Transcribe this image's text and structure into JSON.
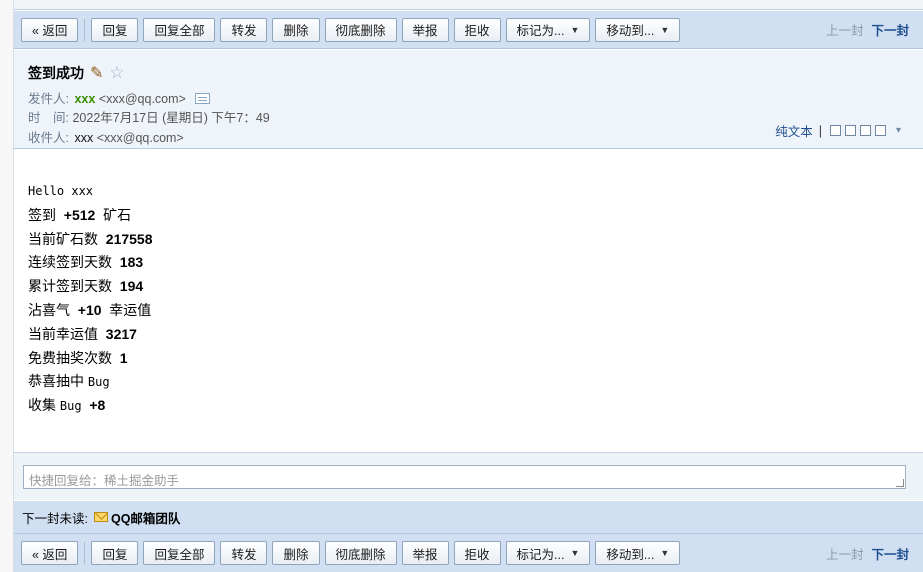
{
  "toolbar": {
    "back": "« 返回",
    "reply": "回复",
    "reply_all": "回复全部",
    "forward": "转发",
    "delete": "删除",
    "delete_permanent": "彻底删除",
    "report": "举报",
    "reject": "拒收",
    "mark_as": "标记为...",
    "move_to": "移动到...",
    "prev": "上一封",
    "next": "下一封"
  },
  "email": {
    "subject": "签到成功",
    "sender_label": "发件人:",
    "sender_name": "xxx",
    "sender_email": "<xxx@qq.com>",
    "time_label": "时　间:",
    "time_value": "2022年7月17日 (星期日) 下午7：49",
    "recipient_label": "收件人:",
    "recipient_name": "xxx",
    "recipient_email": "<xxx@qq.com>",
    "plain_text": "纯文本",
    "body": {
      "greeting": "Hello xxx",
      "l1_a": "签到  ",
      "l1_b": "+512",
      "l1_c": "  矿石",
      "l2_a": "当前矿石数  ",
      "l2_b": "217558",
      "l3_a": "连续签到天数  ",
      "l3_b": "183",
      "l4_a": "累计签到天数  ",
      "l4_b": "194",
      "l5_a": "沾喜气  ",
      "l5_b": "+10",
      "l5_c": "  幸运值",
      "l6_a": "当前幸运值  ",
      "l6_b": "3217",
      "l7_a": "免费抽奖次数  ",
      "l7_b": "1",
      "l8_a": "恭喜抽中 ",
      "l8_b": "Bug",
      "l9_a": "收集 ",
      "l9_b": "Bug",
      "l9_c": "  +8"
    }
  },
  "quick_reply": {
    "placeholder": "快捷回复给：稀土掘金助手"
  },
  "next_unread": {
    "label": "下一封未读:",
    "sender": "QQ邮箱团队"
  }
}
